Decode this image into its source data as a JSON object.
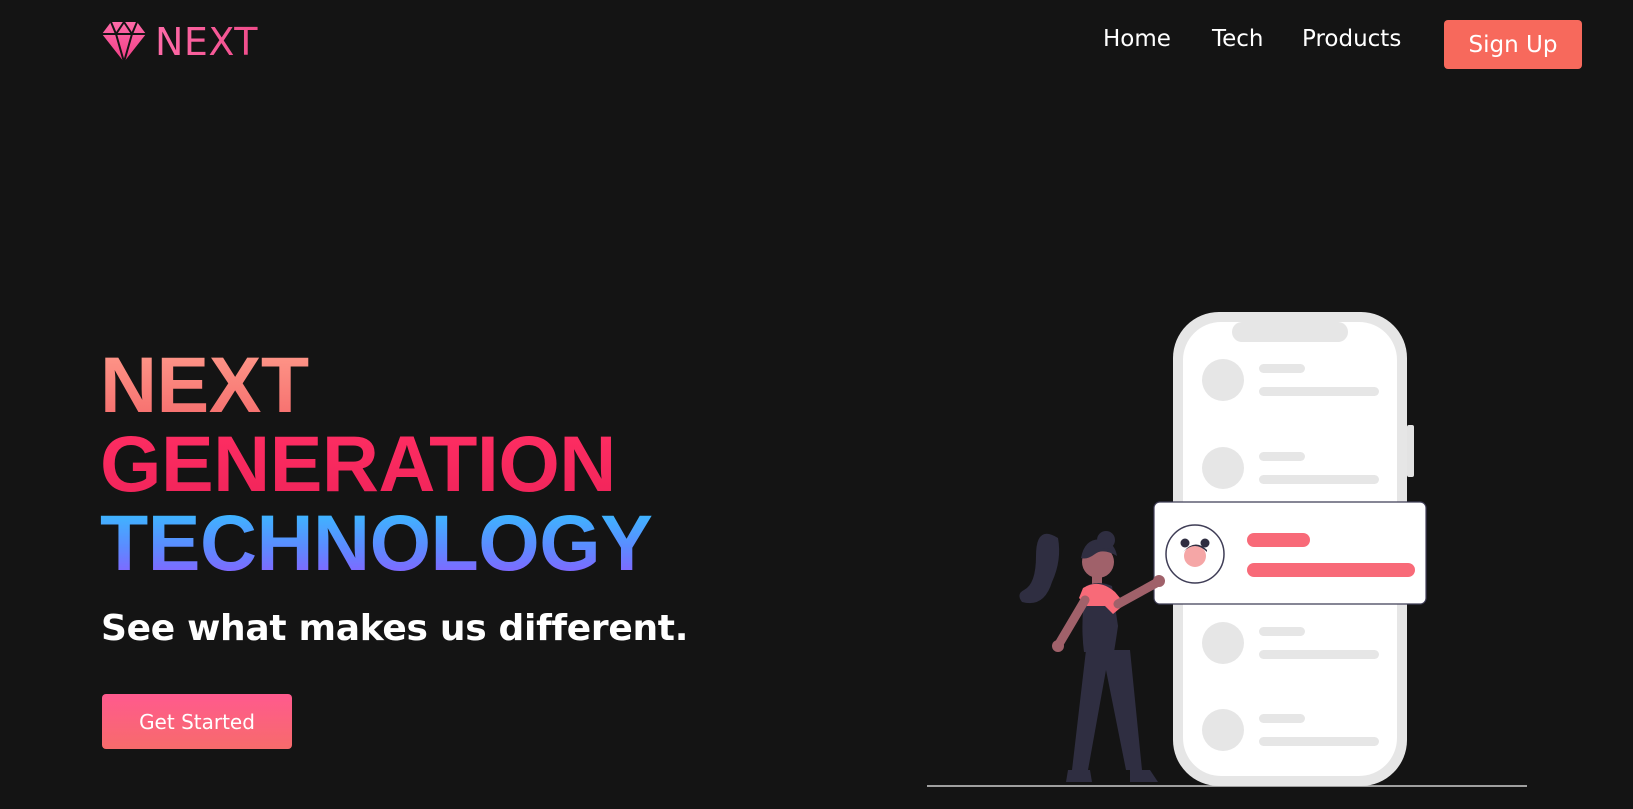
{
  "brand": {
    "name": "NEXT",
    "logo_icon": "diamond-icon",
    "logo_color": "#ff5fa2"
  },
  "nav": {
    "items": [
      {
        "label": "Home"
      },
      {
        "label": "Tech"
      },
      {
        "label": "Products"
      }
    ],
    "signup_label": "Sign Up",
    "signup_color": "#f7695c"
  },
  "hero": {
    "title_lines": [
      "NEXT",
      "GENERATION",
      "TECHNOLOGY"
    ],
    "subtitle": "See what makes us different.",
    "cta_label": "Get Started"
  },
  "colors": {
    "background": "#141414",
    "accent_red": "#ff2e63",
    "accent_coral": "#f7695c",
    "accent_blue": "#34c3ff",
    "accent_purple": "#8d5bff",
    "phone_body": "#f2f2f2",
    "highlight_bar": "#f86a78"
  }
}
